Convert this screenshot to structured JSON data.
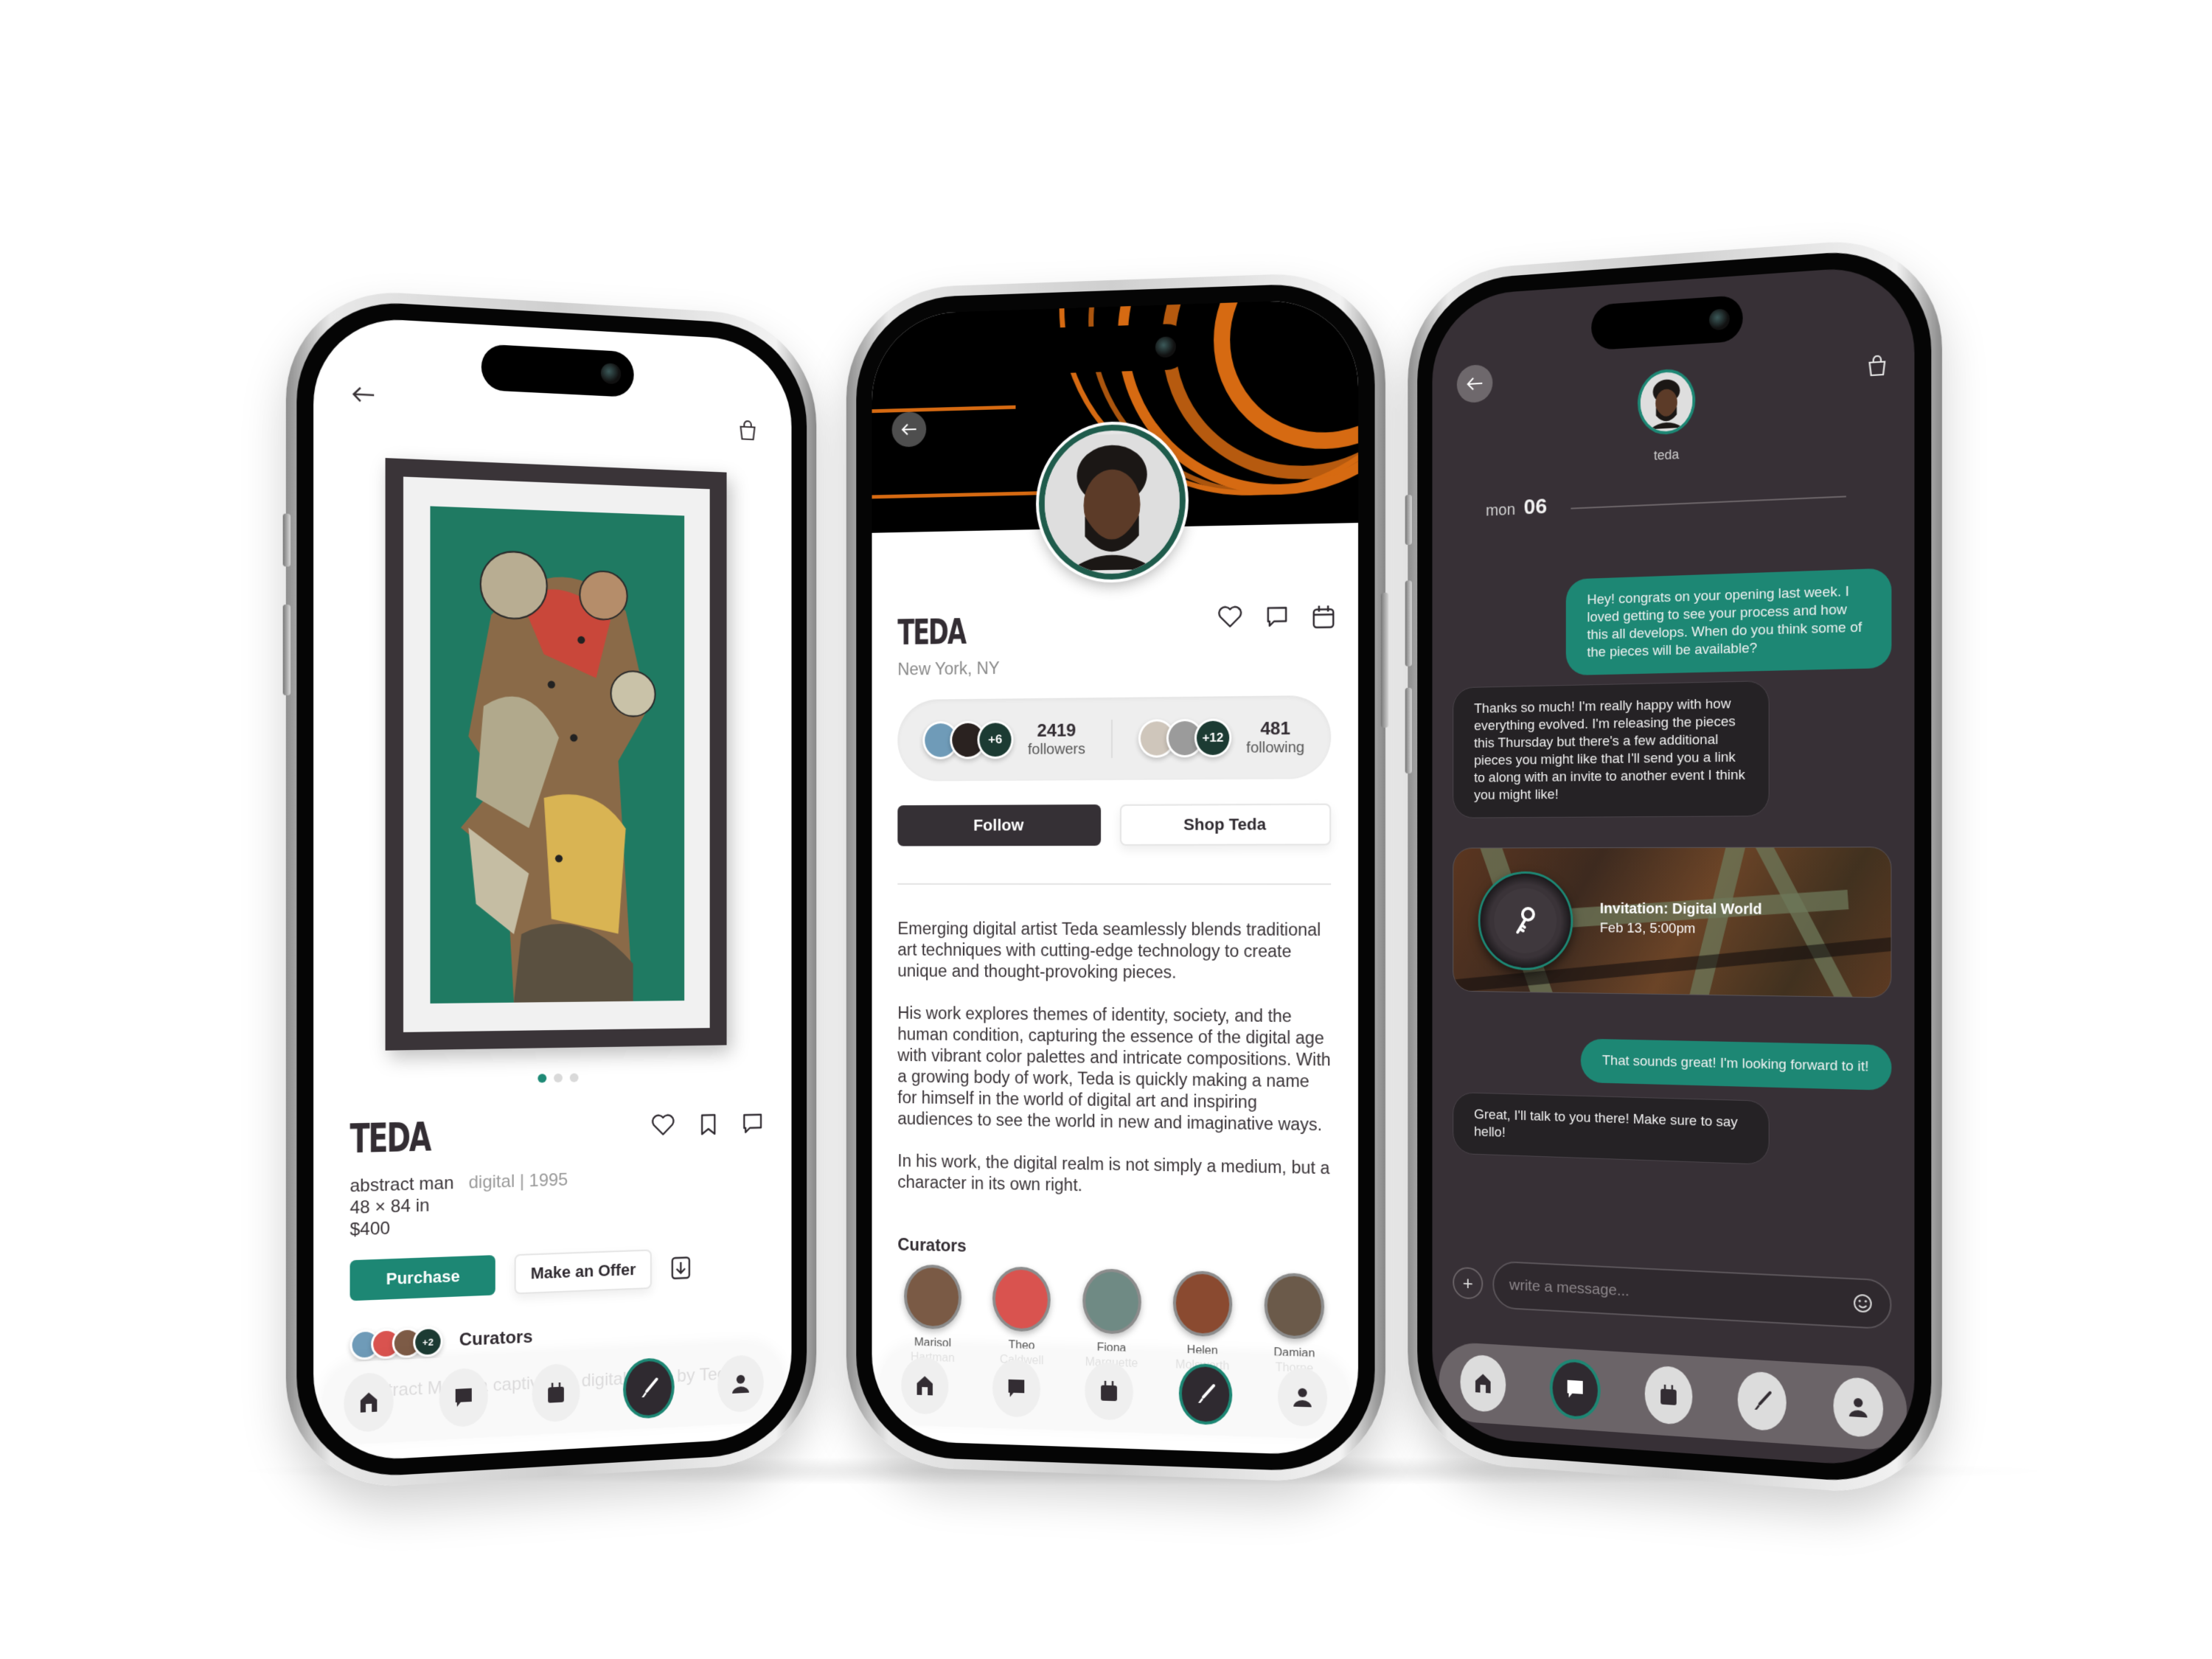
{
  "brand": {
    "accent": "#1d8774",
    "dark": "#353035",
    "chat_bg": "#373036"
  },
  "artwork_screen": {
    "artist": "TEDA",
    "title": "abstract man",
    "medium": "digital",
    "year": "1995",
    "dimensions": "48 × 84 in",
    "price": "$400",
    "carousel": {
      "count": 3,
      "active": 1
    },
    "purchase_label": "Purchase",
    "offer_label": "Make an Offer",
    "curators_label": "Curators",
    "curators_more": "+2",
    "description": "\"Abstract Man,\" a captivating digital piece by Teda."
  },
  "profile_screen": {
    "name": "TEDA",
    "location": "New York, NY",
    "followers": {
      "count": "2419",
      "label": "followers",
      "more": "+6"
    },
    "following": {
      "count": "481",
      "label": "following",
      "more": "+12"
    },
    "follow_label": "Follow",
    "shop_label": "Shop Teda",
    "bio": [
      "Emerging digital artist Teda seamlessly blends traditional art techniques with cutting-edge technology to create unique and thought-provoking pieces.",
      "His  work explores themes of identity, society, and the human condition, capturing the essence of the digital age with vibrant color palettes and intricate compositions. With a growing body of work, Teda is quickly making a name for himself in the world of digital art and inspiring audiences to see the world in new and imaginative ways.",
      "In his work, the digital realm is not simply a medium, but a character in its own right."
    ],
    "curators_label": "Curators",
    "curators": [
      {
        "first": "Marisol",
        "last": "Hartman",
        "color": "#7a5a45"
      },
      {
        "first": "Theo",
        "last": "Caldwell",
        "color": "#d9534f"
      },
      {
        "first": "Fiona",
        "last": "Marquette",
        "color": "#6f8a84"
      },
      {
        "first": "Helen",
        "last": "Molsworth",
        "color": "#8a4a30"
      },
      {
        "first": "Damian",
        "last": "Thorne",
        "color": "#6b5a4a"
      }
    ]
  },
  "chat_screen": {
    "contact": "teda",
    "date_day": "mon",
    "date_num": "06",
    "messages": [
      {
        "from": "me",
        "text": "Hey! congrats on your opening last week. I loved getting to see your process and how this all develops.  When do you think some of the pieces will be available?"
      },
      {
        "from": "teda",
        "text": "Thanks so much! I'm really happy with how everything evolved.  I'm releasing the pieces this Thursday but there's a few additional pieces you might like that I'll send you a link to along with an invite to another event I think you might like!"
      },
      {
        "from": "me",
        "text": "That sounds great! I'm looking forward to it!"
      },
      {
        "from": "teda",
        "text": "Great, I'll talk to you there! Make sure to say hello!"
      }
    ],
    "invite": {
      "title": "Invitation: Digital World",
      "when": "Feb 13, 5:00pm"
    },
    "compose_placeholder": "write a message..."
  },
  "nav": {
    "items": [
      "home",
      "messages",
      "calendar",
      "create",
      "profile"
    ],
    "active_artwork": "create",
    "active_profile": "create",
    "active_chat": "messages"
  }
}
